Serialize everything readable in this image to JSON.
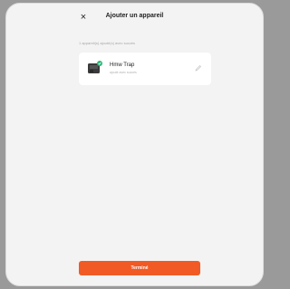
{
  "header": {
    "title": "Ajouter un appareil",
    "close_icon": "close-icon",
    "close_glyph": "×"
  },
  "section": {
    "label": "1 appareil(s) ajouté(s) avec succès"
  },
  "device": {
    "name": "Hmw Trap",
    "status": "ajouté avec succès",
    "icon": "trap-device-icon",
    "badge_icon": "check-icon",
    "edit_icon": "pencil-icon"
  },
  "footer": {
    "finish_label": "Terminé"
  },
  "colors": {
    "accent": "#f15a24",
    "badge": "#2bb673"
  }
}
